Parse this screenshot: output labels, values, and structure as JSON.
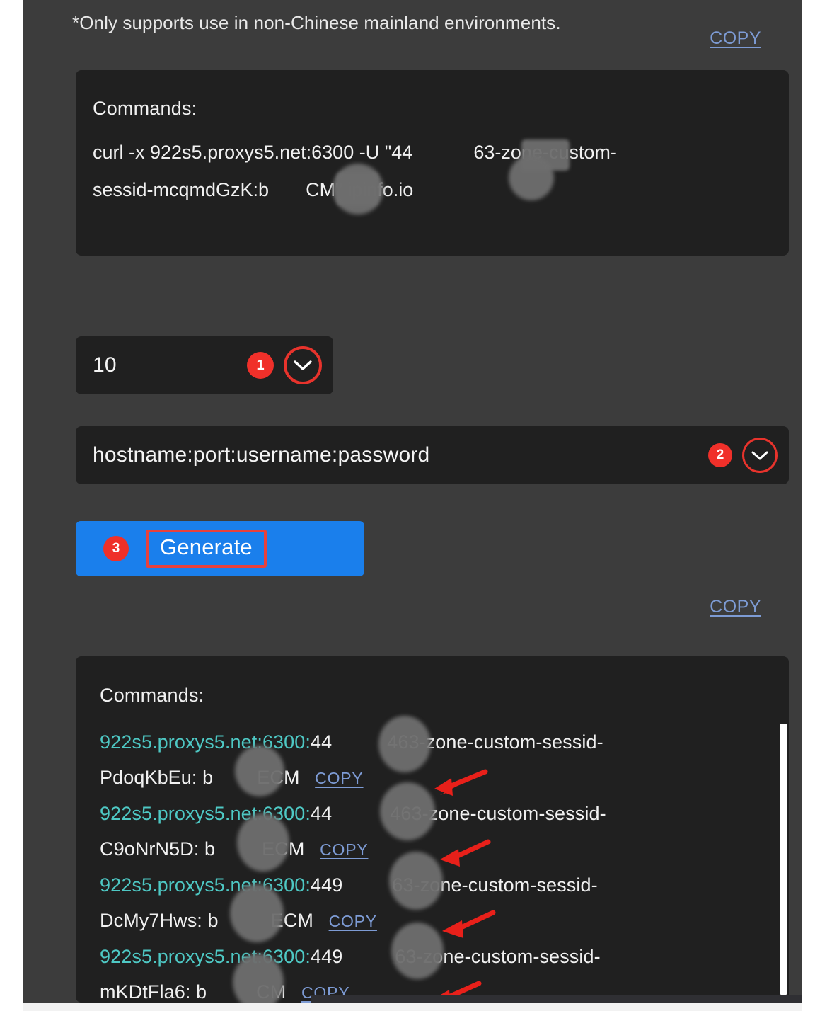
{
  "notice": {
    "text": "*Only supports use in non-Chinese mainland environments."
  },
  "links": {
    "copy_top": "COPY",
    "copy_mid": "COPY",
    "copy_row": "COPY"
  },
  "command_preview": {
    "title": "Commands:",
    "line_1": "curl -x 922s5.proxys5.net:6300 -U \"44",
    "line_1b": "63-zone-custom-",
    "line_2a": "sessid-mcqmdGzK:b",
    "line_2b": "CM\" ipinfo.io"
  },
  "controls": {
    "count_select": {
      "value": "10",
      "badge": "1",
      "icon": "chevron-down-icon"
    },
    "format_select": {
      "value": "hostname:port:username:password",
      "badge": "2",
      "icon": "chevron-down-icon"
    },
    "generate_button": {
      "label": "Generate",
      "badge": "3"
    }
  },
  "results": {
    "title": "Commands:",
    "rows": [
      {
        "host": "922s5.proxys5.net:6300:",
        "user_head": "44",
        "user_tail": "463-zone-custom-sessid-",
        "sessid": "PdoqKbEu:",
        "pass_head": "b",
        "pass_tail": "ECM",
        "copy": "COPY"
      },
      {
        "host": "922s5.proxys5.net:6300:",
        "user_head": "44",
        "user_tail": "463-zone-custom-sessid-",
        "sessid": "C9oNrN5D:",
        "pass_head": "b",
        "pass_tail": "ECM",
        "copy": "COPY"
      },
      {
        "host": "922s5.proxys5.net:6300:",
        "user_head": "449",
        "user_tail": "63-zone-custom-sessid-",
        "sessid": "DcMy7Hws:",
        "pass_head": "b",
        "pass_tail": "ECM",
        "copy": "COPY"
      },
      {
        "host": "922s5.proxys5.net:6300:",
        "user_head": "449",
        "user_tail": "63-zone-custom-sessid-",
        "sessid": "mKDtFla6:",
        "pass_head": "b",
        "pass_tail": "CM",
        "copy": "COPY"
      }
    ]
  },
  "colors": {
    "page_background": "#3c3c3c",
    "panel_background": "#202020",
    "accent_blue": "#1a7fec",
    "link_blue": "#7d9bd4",
    "host_teal": "#4ec8c4",
    "badge_red": "#f0302a",
    "arrow_red": "#e8201a"
  }
}
